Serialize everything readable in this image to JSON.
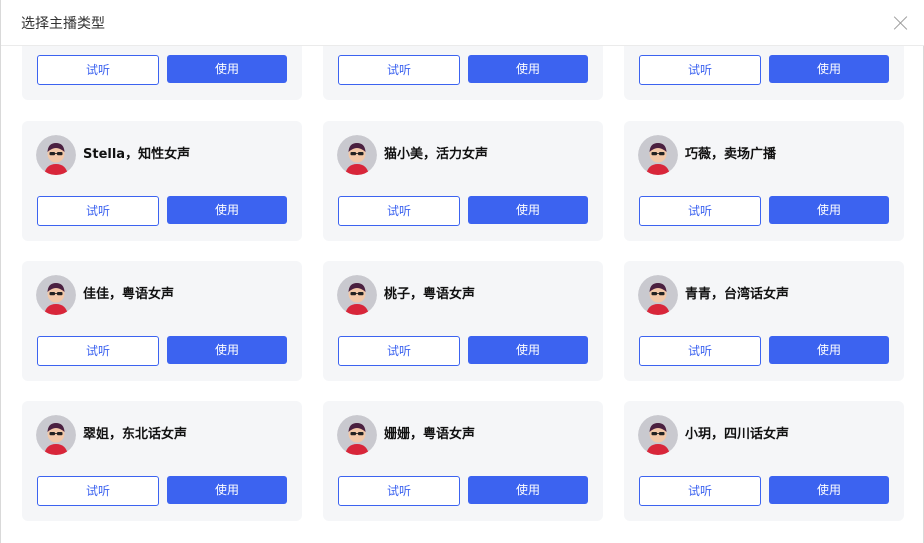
{
  "dialog": {
    "title": "选择主播类型"
  },
  "cards": [
    {
      "name": "",
      "listen_label": "试听",
      "use_label": "使用"
    },
    {
      "name": "",
      "listen_label": "试听",
      "use_label": "使用"
    },
    {
      "name": "",
      "listen_label": "试听",
      "use_label": "使用"
    },
    {
      "name": "Stella，知性女声",
      "listen_label": "试听",
      "use_label": "使用"
    },
    {
      "name": "猫小美，活力女声",
      "listen_label": "试听",
      "use_label": "使用"
    },
    {
      "name": "巧薇，卖场广播",
      "listen_label": "试听",
      "use_label": "使用"
    },
    {
      "name": "佳佳，粤语女声",
      "listen_label": "试听",
      "use_label": "使用"
    },
    {
      "name": "桃子，粤语女声",
      "listen_label": "试听",
      "use_label": "使用"
    },
    {
      "name": "青青，台湾话女声",
      "listen_label": "试听",
      "use_label": "使用"
    },
    {
      "name": "翠姐，东北话女声",
      "listen_label": "试听",
      "use_label": "使用"
    },
    {
      "name": "姗姗，粤语女声",
      "listen_label": "试听",
      "use_label": "使用"
    },
    {
      "name": "小玥，四川话女声",
      "listen_label": "试听",
      "use_label": "使用"
    }
  ]
}
